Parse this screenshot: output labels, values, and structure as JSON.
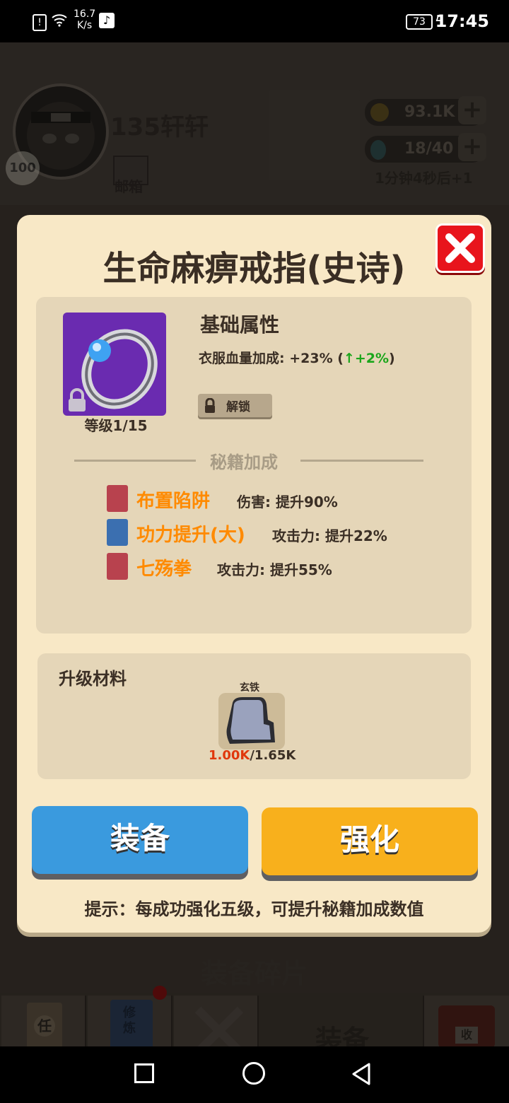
{
  "status_bar": {
    "net_speed": "16.7",
    "net_unit": "K/s",
    "battery": "73",
    "time": "17:45"
  },
  "background": {
    "player_name": "135轩轩",
    "player_level": "100",
    "mail_label": "邮箱",
    "gold": "93.1K",
    "energy": "18/40",
    "regen_timer": "1分钟4秒后+1",
    "section_title": "装备碎片",
    "nav_train_label": "修炼",
    "nav_task_label": "任",
    "nav_collect_label": "收",
    "nav_equip_label": "装备"
  },
  "modal": {
    "title": "生命麻痹戒指(史诗)",
    "item_level": "等级1/15",
    "base_attr_title": "基础属性",
    "attr_label": "衣服血量加成: +23% (",
    "attr_up_arrow": "↑",
    "attr_bonus": "+2%",
    "attr_close": ")",
    "unlock_label": "解锁",
    "secret_section_title": "秘籍加成",
    "skills": [
      {
        "name": "布置陷阱",
        "desc": "伤害: 提升90%",
        "book_color": "#b8424e"
      },
      {
        "name": "功力提升(大)",
        "desc": "攻击力: 提升22%",
        "book_color": "#3b6fb0"
      },
      {
        "name": "七殇拳",
        "desc": "攻击力: 提升55%",
        "book_color": "#b8424e"
      }
    ],
    "materials_title": "升级材料",
    "material": {
      "name": "玄铁",
      "have": "1.00K",
      "need": "/1.65K"
    },
    "equip_button": "装备",
    "upgrade_button": "强化",
    "tip": "提示：每成功强化五级，可提升秘籍加成数值"
  },
  "colors": {
    "modal_bg": "#f8e8c6",
    "panel_bg": "#e5d6b8",
    "skill_name": "#ff8a00",
    "bonus_green": "#1ba61b",
    "equip_button": "#3a9ade",
    "upgrade_button": "#f8b01c",
    "close_button": "#e8141c",
    "item_frame": "#6a2bb0"
  }
}
